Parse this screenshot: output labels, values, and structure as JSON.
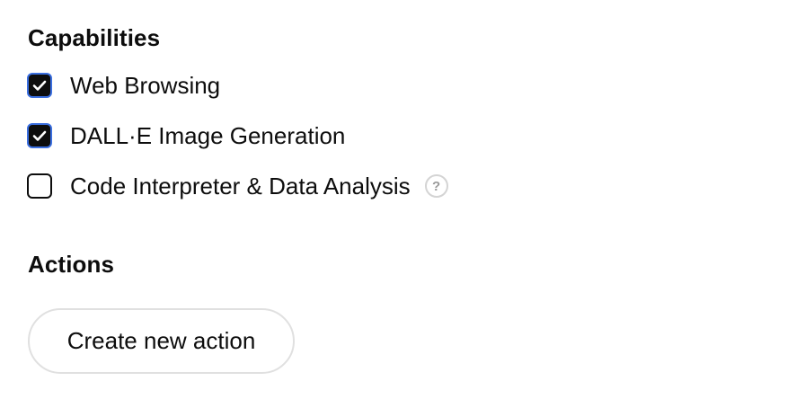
{
  "capabilities": {
    "title": "Capabilities",
    "items": [
      {
        "label": "Web Browsing",
        "checked": true
      },
      {
        "label": "DALL·E Image Generation",
        "checked": true
      },
      {
        "label": "Code Interpreter & Data Analysis",
        "checked": false,
        "help": "?"
      }
    ]
  },
  "actions": {
    "title": "Actions",
    "create_label": "Create new action"
  },
  "colors": {
    "text": "#0d0d0d",
    "checkbox_focus_ring": "#3b6fe0",
    "help_icon": "#9a9a9a",
    "button_border": "#e0e0e0"
  }
}
